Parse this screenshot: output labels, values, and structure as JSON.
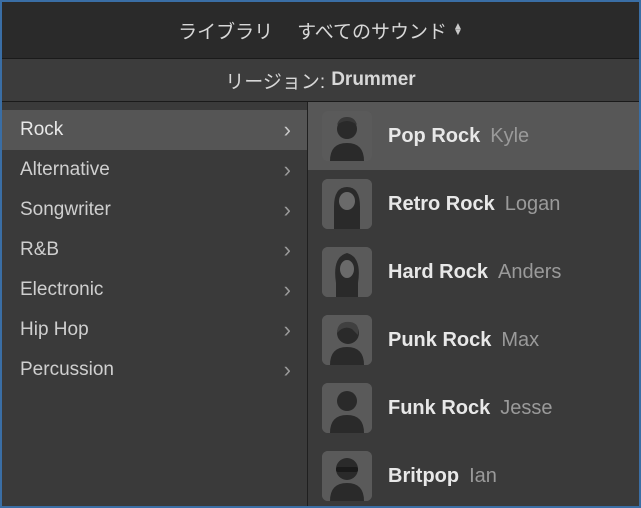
{
  "header": {
    "library_label": "ライブラリ",
    "sounds_label": "すべてのサウンド"
  },
  "region": {
    "prefix": "リージョン:",
    "name": "Drummer"
  },
  "categories": [
    {
      "label": "Rock",
      "selected": true
    },
    {
      "label": "Alternative",
      "selected": false
    },
    {
      "label": "Songwriter",
      "selected": false
    },
    {
      "label": "R&B",
      "selected": false
    },
    {
      "label": "Electronic",
      "selected": false
    },
    {
      "label": "Hip Hop",
      "selected": false
    },
    {
      "label": "Percussion",
      "selected": false
    }
  ],
  "drummers": [
    {
      "style": "Pop Rock",
      "name": "Kyle",
      "selected": true,
      "avatar": "male-short"
    },
    {
      "style": "Retro Rock",
      "name": "Logan",
      "selected": false,
      "avatar": "male-longhair"
    },
    {
      "style": "Hard Rock",
      "name": "Anders",
      "selected": false,
      "avatar": "male-longhair2"
    },
    {
      "style": "Punk Rock",
      "name": "Max",
      "selected": false,
      "avatar": "male-side"
    },
    {
      "style": "Funk Rock",
      "name": "Jesse",
      "selected": false,
      "avatar": "male-short2"
    },
    {
      "style": "Britpop",
      "name": "Ian",
      "selected": false,
      "avatar": "male-glasses"
    }
  ]
}
